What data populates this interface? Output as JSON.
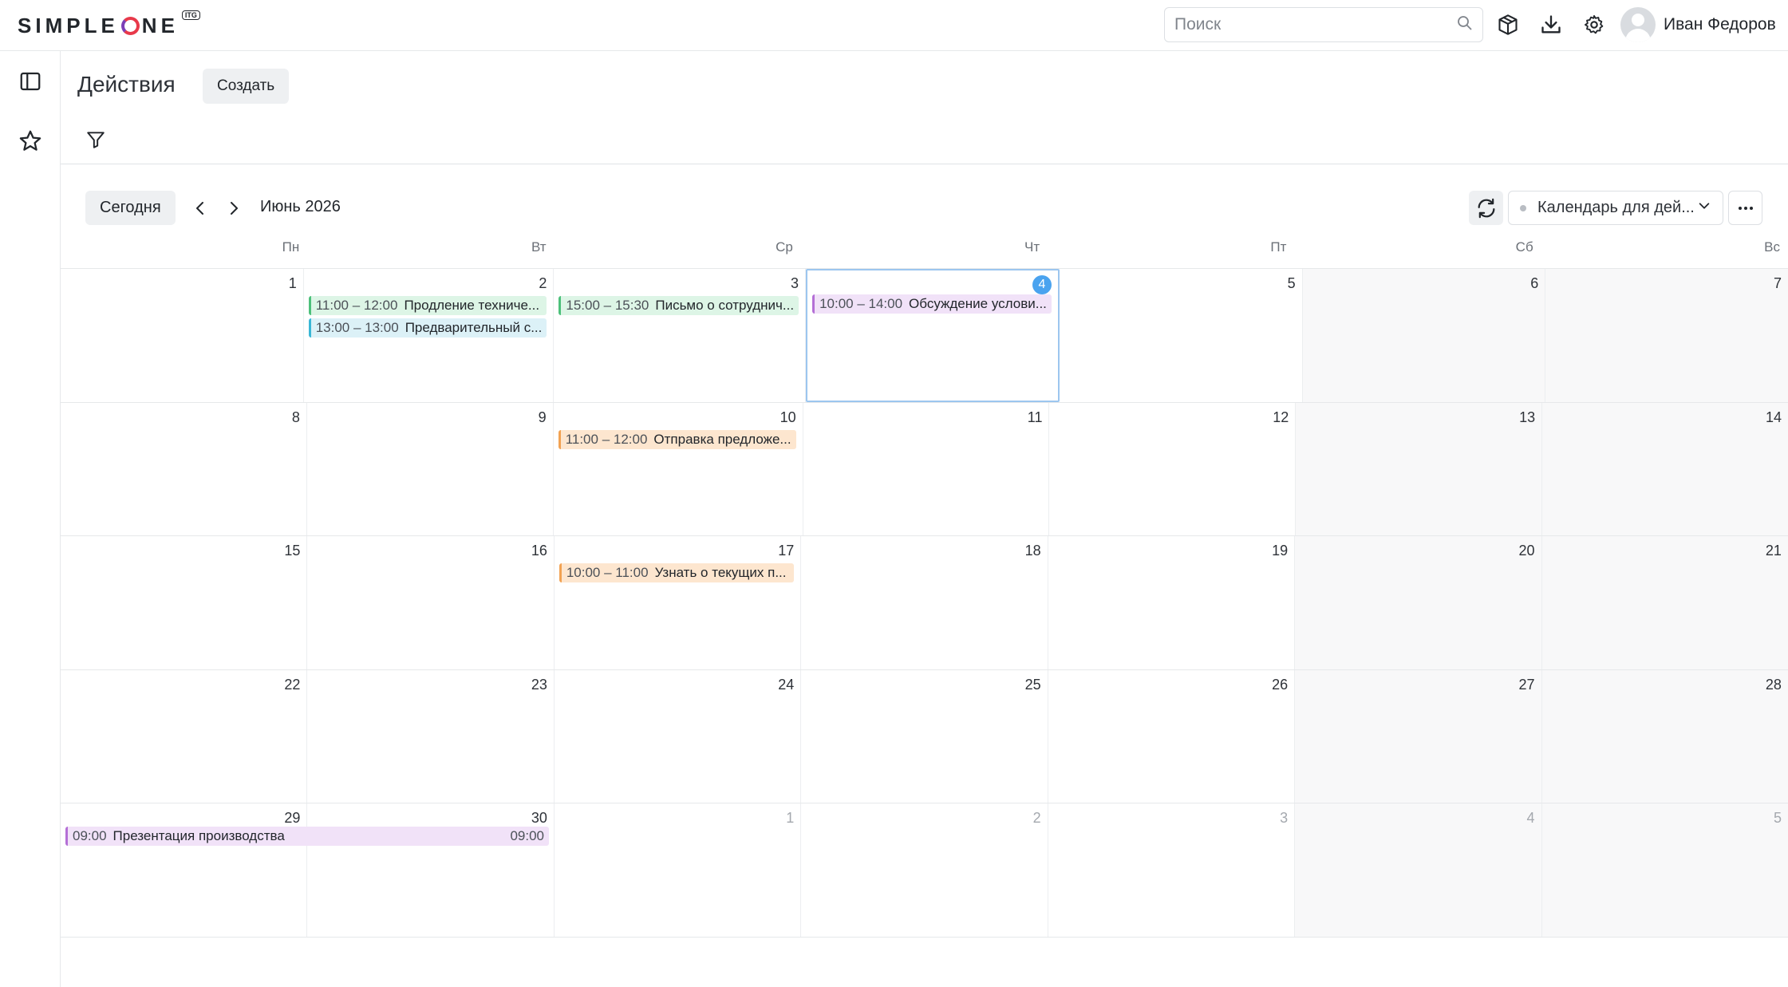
{
  "app": {
    "logo_text": "SIMPLEONE",
    "logo_badge": "ITG"
  },
  "search": {
    "placeholder": "Поиск"
  },
  "user": {
    "name": "Иван Федоров"
  },
  "header": {
    "title": "Действия",
    "create_label": "Создать"
  },
  "toolbar": {
    "today_label": "Сегодня",
    "month": "Июнь 2026",
    "calendar_name": "Календарь для дей..."
  },
  "days_of_week": [
    "Пн",
    "Вт",
    "Ср",
    "Чт",
    "Пт",
    "Сб",
    "Вс"
  ],
  "weeks": [
    {
      "days": [
        {
          "num": "1"
        },
        {
          "num": "2",
          "events": [
            {
              "time": "11:00 – 12:00",
              "title": "Продление техниче...",
              "color": "green"
            },
            {
              "time": "13:00 – 13:00",
              "title": "Предварительный с...",
              "color": "cyan"
            }
          ]
        },
        {
          "num": "3",
          "events": [
            {
              "time": "15:00 – 15:30",
              "title": "Письмо о сотруднич...",
              "color": "green"
            }
          ]
        },
        {
          "num": "4",
          "today": true,
          "events": [
            {
              "time": "10:00 – 14:00",
              "title": "Обсуждение услови...",
              "color": "purple"
            }
          ]
        },
        {
          "num": "5"
        },
        {
          "num": "6"
        },
        {
          "num": "7"
        }
      ]
    },
    {
      "days": [
        {
          "num": "8"
        },
        {
          "num": "9"
        },
        {
          "num": "10",
          "events": [
            {
              "time": "11:00 – 12:00",
              "title": "Отправка предложе...",
              "color": "orange"
            }
          ]
        },
        {
          "num": "11"
        },
        {
          "num": "12"
        },
        {
          "num": "13"
        },
        {
          "num": "14"
        }
      ]
    },
    {
      "days": [
        {
          "num": "15"
        },
        {
          "num": "16"
        },
        {
          "num": "17",
          "events": [
            {
              "time": "10:00 – 11:00",
              "title": "Узнать о текущих п...",
              "color": "orange"
            }
          ]
        },
        {
          "num": "18"
        },
        {
          "num": "19"
        },
        {
          "num": "20"
        },
        {
          "num": "21"
        }
      ]
    },
    {
      "days": [
        {
          "num": "22"
        },
        {
          "num": "23"
        },
        {
          "num": "24"
        },
        {
          "num": "25"
        },
        {
          "num": "26"
        },
        {
          "num": "27"
        },
        {
          "num": "28"
        }
      ]
    },
    {
      "days": [
        {
          "num": "29"
        },
        {
          "num": "30"
        },
        {
          "num": "1",
          "out": true
        },
        {
          "num": "2",
          "out": true
        },
        {
          "num": "3",
          "out": true
        },
        {
          "num": "4",
          "out": true
        },
        {
          "num": "5",
          "out": true
        }
      ]
    }
  ],
  "spanning_event": {
    "start_time": "09:00",
    "title": "Презентация производства",
    "end_time": "09:00",
    "color": "purple"
  },
  "colors": {
    "accent": "#4aa3ef",
    "green": "#4cc07a",
    "cyan": "#39b7d6",
    "orange": "#f2a253",
    "purple": "#b46fd6"
  }
}
